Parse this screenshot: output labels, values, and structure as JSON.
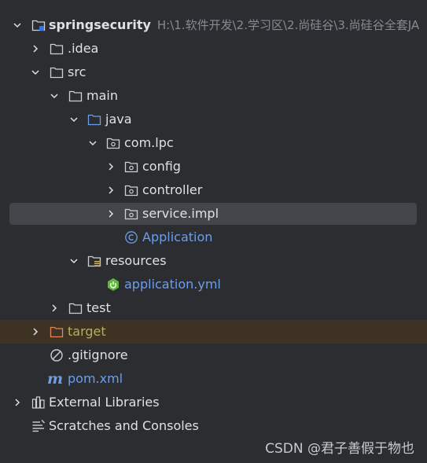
{
  "colors": {
    "background": "#2b2d30",
    "selection": "#43454a",
    "excluded_row": "#3d3223",
    "text": "#dfe1e5",
    "path_hint": "#868a91",
    "java_blue": "#6e9ee8",
    "excluded_text": "#b3ae60",
    "spring_green": "#5fb83b"
  },
  "tree": {
    "root": {
      "label": "springsecurity",
      "path": "H:\\1.软件开发\\2.学习区\\2.尚硅谷\\3.尚硅谷全套JA",
      "icon": "module-folder-icon"
    },
    "idea": {
      "label": ".idea",
      "icon": "folder-icon"
    },
    "src": {
      "label": "src",
      "icon": "folder-icon"
    },
    "main": {
      "label": "main",
      "icon": "folder-icon"
    },
    "java": {
      "label": "java",
      "icon": "source-root-folder-icon"
    },
    "com_lpc": {
      "label": "com.lpc",
      "icon": "package-icon"
    },
    "config": {
      "label": "config",
      "icon": "package-icon"
    },
    "controller": {
      "label": "controller",
      "icon": "package-icon"
    },
    "service_impl": {
      "label": "service.impl",
      "icon": "package-icon"
    },
    "application": {
      "label": "Application",
      "icon": "class-icon"
    },
    "resources": {
      "label": "resources",
      "icon": "resources-folder-icon"
    },
    "application_yml": {
      "label": "application.yml",
      "icon": "spring-config-icon"
    },
    "test": {
      "label": "test",
      "icon": "folder-icon"
    },
    "target": {
      "label": "target",
      "icon": "excluded-folder-icon"
    },
    "gitignore": {
      "label": ".gitignore",
      "icon": "ignore-file-icon"
    },
    "pom": {
      "label": "pom.xml",
      "icon": "maven-icon"
    },
    "external_libraries": {
      "label": "External Libraries",
      "icon": "libraries-icon"
    },
    "scratches": {
      "label": "Scratches and Consoles",
      "icon": "scratches-icon"
    }
  },
  "watermark": "CSDN @君子善假于物也"
}
